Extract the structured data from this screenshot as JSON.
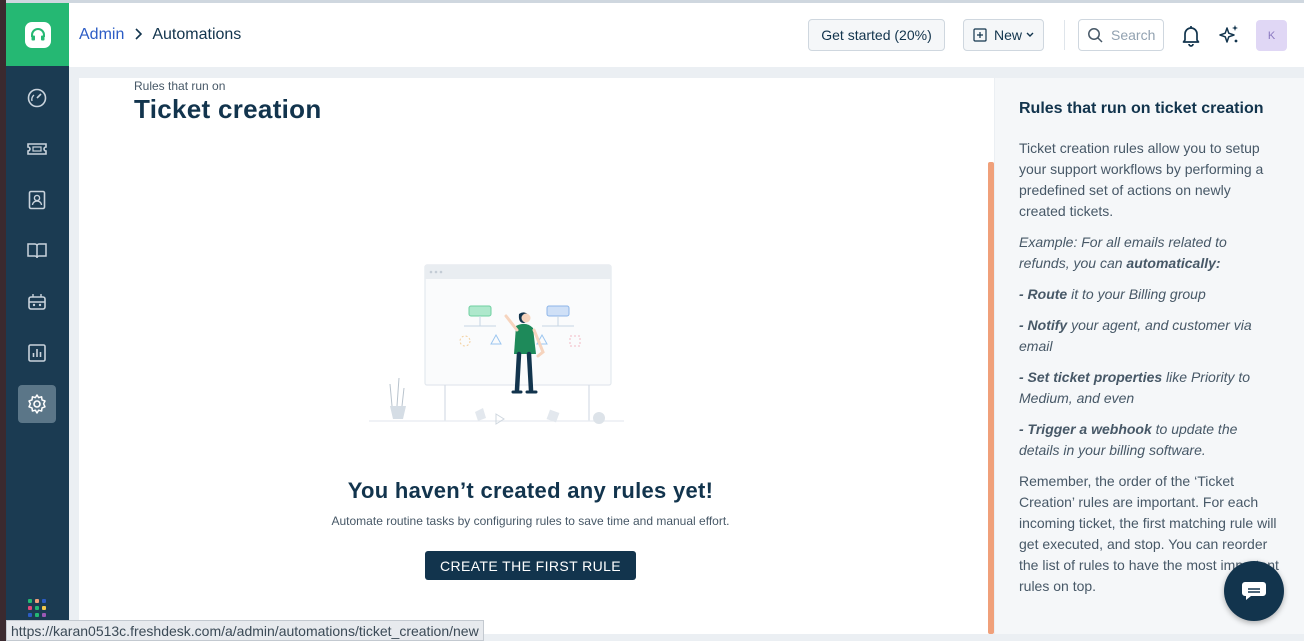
{
  "header": {
    "breadcrumb_parent": "Admin",
    "breadcrumb_current": "Automations",
    "get_started_label": "Get started (20%)",
    "new_label": "New",
    "search_placeholder": "Search",
    "avatar_initial": "K"
  },
  "page": {
    "pretitle": "Rules that run on",
    "title": "Ticket creation"
  },
  "empty_state": {
    "title": "You haven’t created any rules yet!",
    "subtitle": "Automate routine tasks by configuring rules to save time and manual effort.",
    "cta_label": "CREATE THE FIRST RULE"
  },
  "info_panel": {
    "title": "Rules that run on ticket creation",
    "intro": "Ticket creation rules allow you to setup your support workflows by performing a predefined set of actions on newly created tickets.",
    "example_prefix": "Example: For all emails related to refunds, you can ",
    "example_bold": "automatically:",
    "items": [
      {
        "bold": "- Route",
        "rest": " it to your Billing group"
      },
      {
        "bold": "- Notify",
        "rest": " your agent, and customer via email"
      },
      {
        "bold": "- Set ticket properties",
        "rest": " like Priority to Medium, and even"
      },
      {
        "bold": "- Trigger a webhook",
        "rest": " to update the details in your billing software."
      }
    ],
    "remember": "Remember, the order of the ‘Ticket Creation’ rules are important. For each incoming ticket, the first matching rule will get executed, and stop. You can reorder the list of rules to have the most important rules on top."
  },
  "sidebar": {
    "items": [
      {
        "icon": "dashboard-icon"
      },
      {
        "icon": "tickets-icon"
      },
      {
        "icon": "contacts-icon"
      },
      {
        "icon": "solutions-book-icon"
      },
      {
        "icon": "bot-icon"
      },
      {
        "icon": "reports-icon"
      },
      {
        "icon": "admin-gear-icon",
        "active": true
      }
    ]
  },
  "status_bar": {
    "url": "https://karan0513c.freshdesk.com/a/admin/automations/ticket_creation/new"
  },
  "colors": {
    "brand_green": "#25b873",
    "sidebar_bg": "#1b3b52",
    "primary_dark": "#12344d",
    "link_blue": "#2c5cc5",
    "accent_orange": "#f0a07a"
  }
}
